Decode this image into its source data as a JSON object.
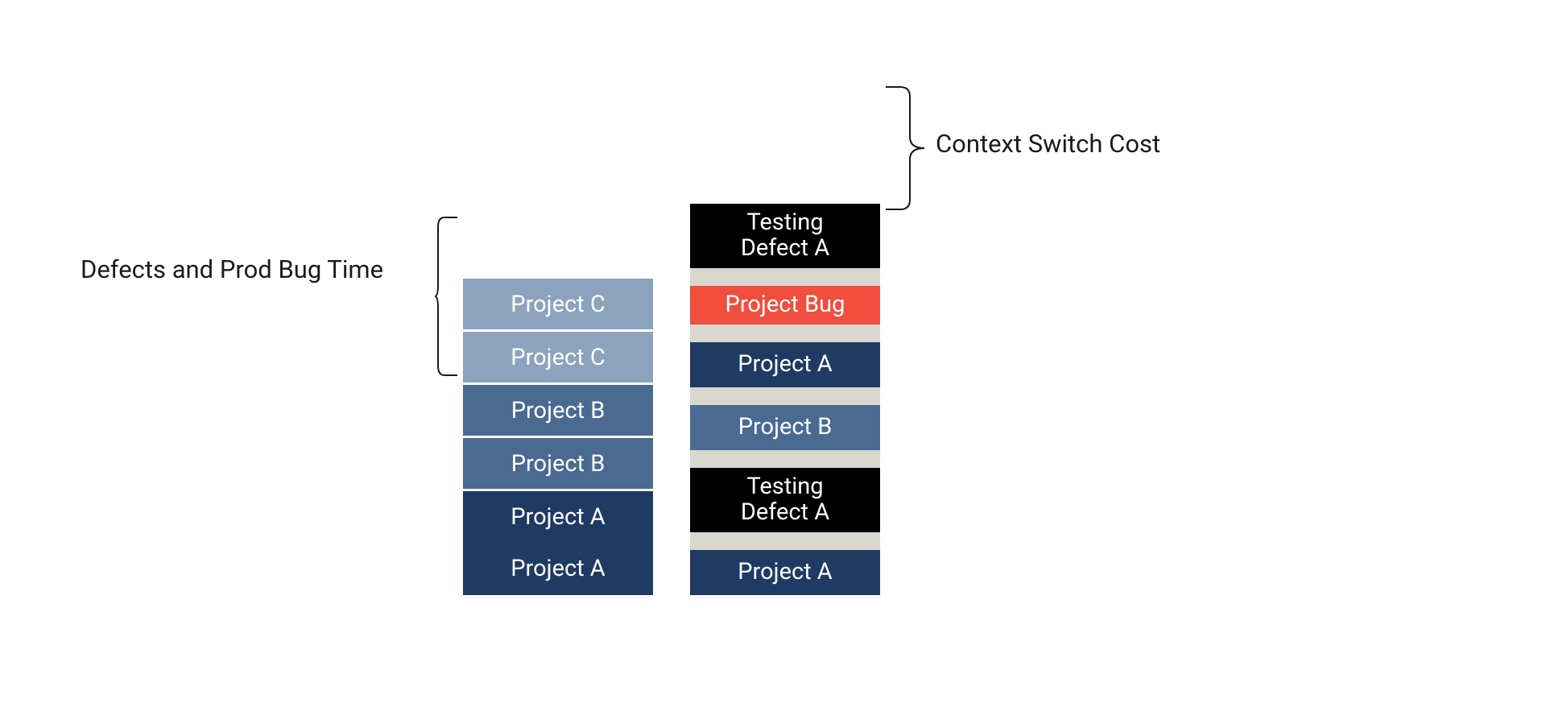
{
  "colors": {
    "projectA": "#1f3a63",
    "projectB": "#4a6a92",
    "projectC": "#8ba3bd",
    "defect": "#000000",
    "bug": "#f04e3e",
    "gap": "#dad8ce"
  },
  "labels": {
    "left": "Defects and Prod Bug Time",
    "right": "Context Switch Cost"
  },
  "leftStack": [
    {
      "label": "Project A",
      "colorKey": "projectA"
    },
    {
      "label": "Project A",
      "colorKey": "projectA"
    },
    {
      "label": "Project B",
      "colorKey": "projectB"
    },
    {
      "label": "Project B",
      "colorKey": "projectB"
    },
    {
      "label": "Project C",
      "colorKey": "projectC"
    },
    {
      "label": "Project C",
      "colorKey": "projectC"
    }
  ],
  "rightStack": [
    {
      "type": "block",
      "label": "Project A",
      "colorKey": "projectA",
      "hClass": "h-single"
    },
    {
      "type": "gap"
    },
    {
      "type": "block",
      "label": "Testing\nDefect A",
      "colorKey": "defect",
      "hClass": "h-double"
    },
    {
      "type": "gap"
    },
    {
      "type": "block",
      "label": "Project B",
      "colorKey": "projectB",
      "hClass": "h-single"
    },
    {
      "type": "gap"
    },
    {
      "type": "block",
      "label": "Project A",
      "colorKey": "projectA",
      "hClass": "h-single"
    },
    {
      "type": "gap"
    },
    {
      "type": "block",
      "label": "Project Bug",
      "colorKey": "bug",
      "hClass": "h-bug"
    },
    {
      "type": "gap"
    },
    {
      "type": "block",
      "label": "Testing\nDefect A",
      "colorKey": "defect",
      "hClass": "h-double"
    }
  ]
}
